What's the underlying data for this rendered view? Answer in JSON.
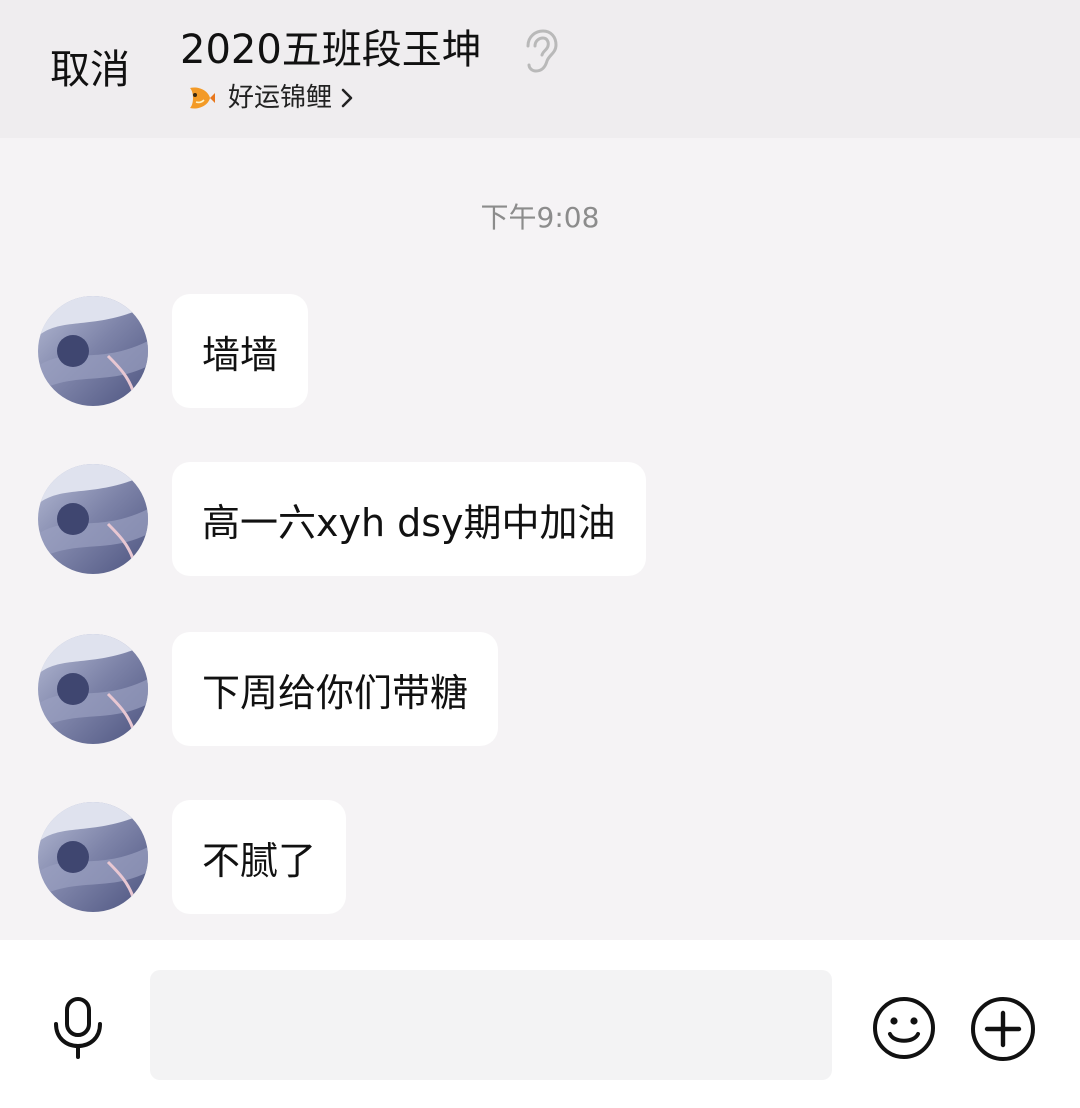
{
  "header": {
    "cancel_label": "取消",
    "title": "2020五班段玉坤",
    "subtitle": "好运锦鲤",
    "ear_icon": "ear-icon",
    "koi_icon": "koi-fish-icon",
    "chevron_icon": "chevron-right-icon"
  },
  "chat": {
    "timestamp": "下午9:08",
    "messages": [
      {
        "text": "墙墙"
      },
      {
        "text": "高一六xyh dsy期中加油"
      },
      {
        "text": "下周给你们带糖"
      },
      {
        "text": "不腻了"
      }
    ]
  },
  "input_bar": {
    "mic_icon": "microphone-icon",
    "input_value": "",
    "input_placeholder": "",
    "emoji_icon": "emoji-smile-icon",
    "plus_icon": "plus-circle-icon"
  },
  "colors": {
    "header_bg": "#efedef",
    "chat_bg": "#f5f3f5",
    "bubble_bg": "#ffffff",
    "timestamp": "#8c8c8c"
  }
}
